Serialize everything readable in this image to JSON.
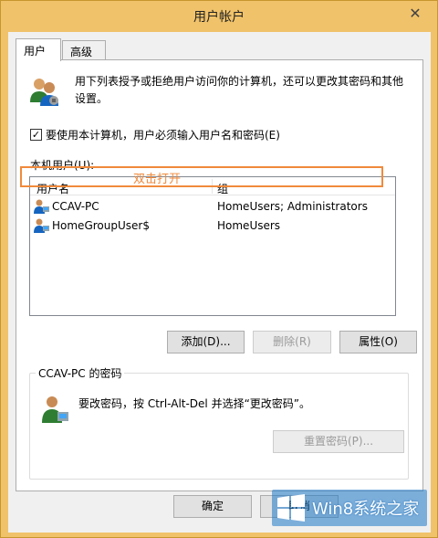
{
  "window": {
    "title": "用户帐户",
    "close_glyph": "✕"
  },
  "tabs": [
    {
      "label": "用户"
    },
    {
      "label": "高级"
    }
  ],
  "intro_text": "用下列表授予或拒绝用户访问你的计算机，还可以更改其密码和其他设置。",
  "require_login": {
    "label": "要使用本计算机，用户必须输入用户名和密码(E)",
    "check_glyph": "✓"
  },
  "local_users_label": "本机用户(U):",
  "listview": {
    "columns": [
      "用户名",
      "组"
    ],
    "rows": [
      {
        "name": "CCAV-PC",
        "group": "HomeUsers; Administrators"
      },
      {
        "name": "HomeGroupUser$",
        "group": "HomeUsers"
      }
    ]
  },
  "annotation": "双击打开",
  "buttons": {
    "add": "添加(D)...",
    "remove": "删除(R)",
    "properties": "属性(O)",
    "reset_password": "重置密码(P)...",
    "ok": "确定",
    "cancel": "取消"
  },
  "password_group": {
    "legend": "CCAV-PC 的密码",
    "text": "要改密码，按 Ctrl-Alt-Del 并选择“更改密码”。"
  },
  "watermark": {
    "text": "Win8系统之家"
  },
  "colors": {
    "title_bar": "#f0c26a",
    "highlight": "#f08a3c"
  }
}
